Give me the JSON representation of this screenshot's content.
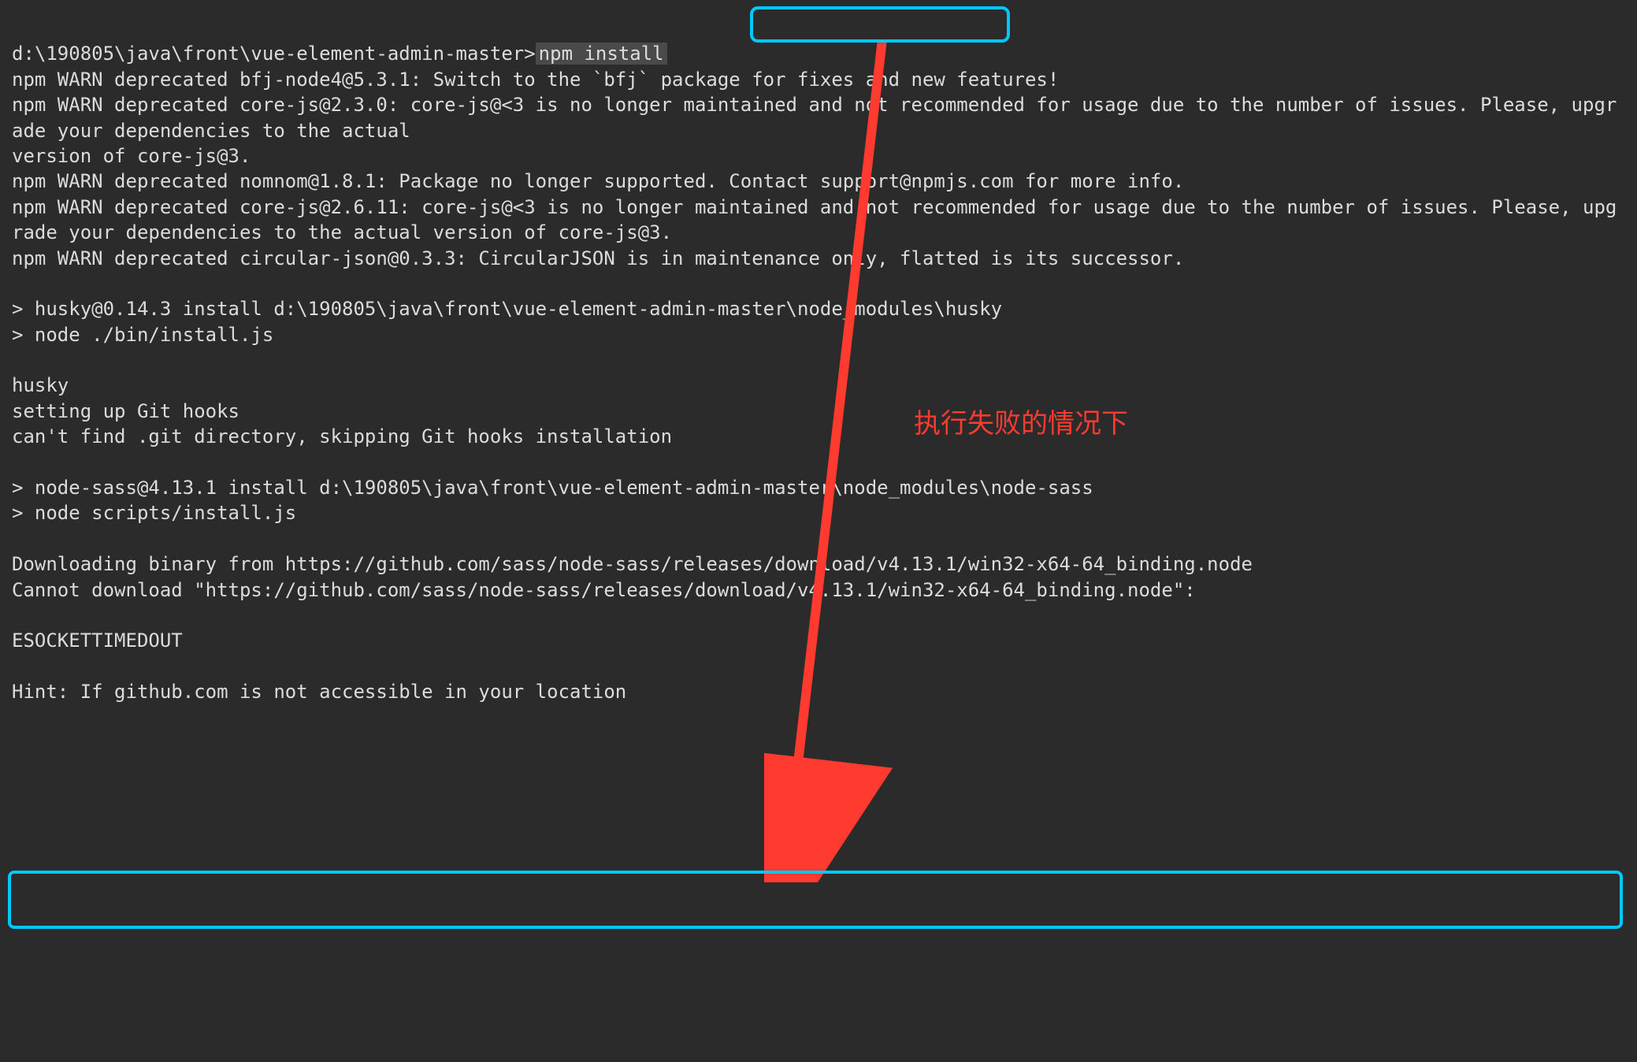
{
  "prompt_path": "d:\\190805\\java\\front\\vue-element-admin-master>",
  "command": "npm install",
  "lines": [
    "npm WARN deprecated bfj-node4@5.3.1: Switch to the `bfj` package for fixes and new features!",
    "npm WARN deprecated core-js@2.3.0: core-js@<3 is no longer maintained and not recommended for usage due to the number of issues. Please, upgrade your dependencies to the actual",
    "version of core-js@3.",
    "npm WARN deprecated nomnom@1.8.1: Package no longer supported. Contact support@npmjs.com for more info.",
    "npm WARN deprecated core-js@2.6.11: core-js@<3 is no longer maintained and not recommended for usage due to the number of issues. Please, upgrade your dependencies to the actual version of core-js@3.",
    "npm WARN deprecated circular-json@0.3.3: CircularJSON is in maintenance only, flatted is its successor.",
    "",
    "> husky@0.14.3 install d:\\190805\\java\\front\\vue-element-admin-master\\node_modules\\husky",
    "> node ./bin/install.js",
    "",
    "husky",
    "setting up Git hooks",
    "can't find .git directory, skipping Git hooks installation",
    "",
    "> node-sass@4.13.1 install d:\\190805\\java\\front\\vue-element-admin-master\\node_modules\\node-sass",
    "> node scripts/install.js",
    "",
    "Downloading binary from https://github.com/sass/node-sass/releases/download/v4.13.1/win32-x64-64_binding.node",
    "Cannot download \"https://github.com/sass/node-sass/releases/download/v4.13.1/win32-x64-64_binding.node\":",
    "",
    "ESOCKETTIMEDOUT",
    "",
    "Hint: If github.com is not accessible in your location"
  ],
  "annotation": "执行失败的情况下"
}
